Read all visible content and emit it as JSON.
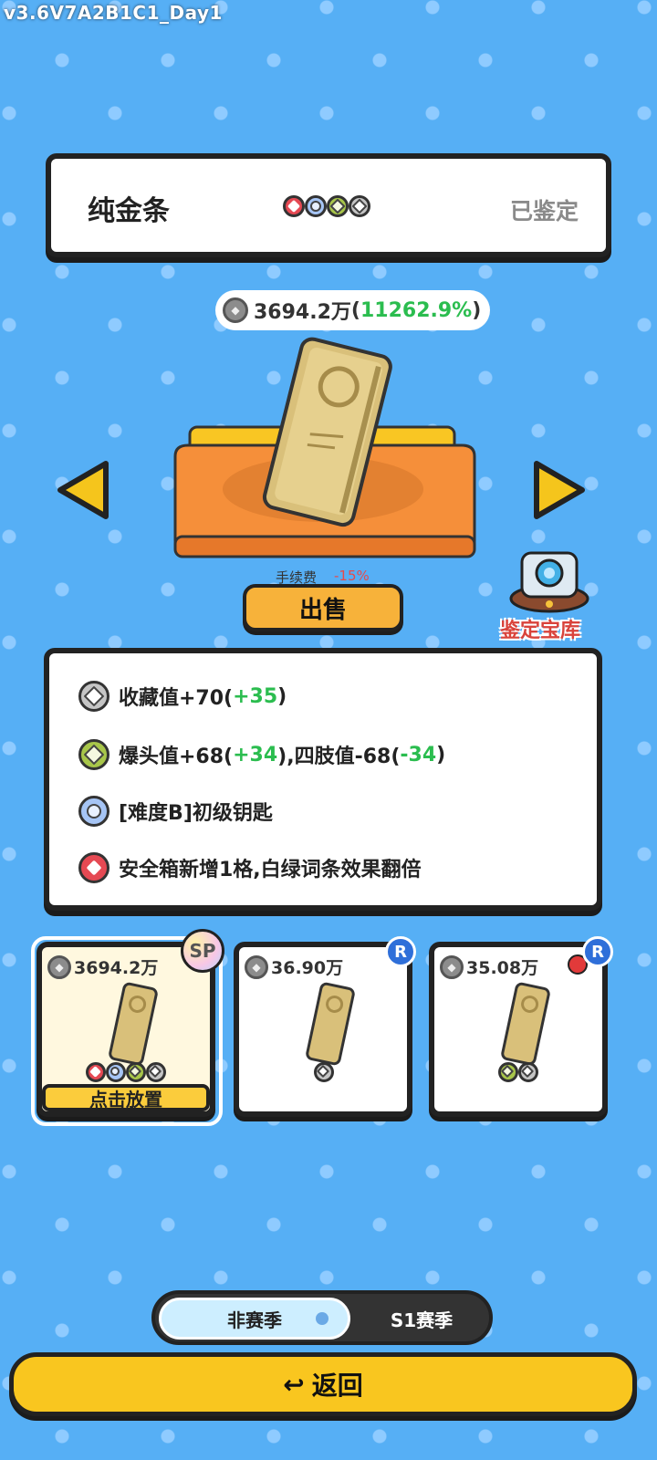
{
  "version": "v3.6V7A2B1C1_Day1",
  "item": {
    "name": "纯金条",
    "status": "已鉴定",
    "price": "3694.2万",
    "change": "11262.9%"
  },
  "sale": {
    "fee_label": "手续费",
    "fee_pct": "-15%",
    "sell_label": "出售"
  },
  "vault": {
    "label": "鉴定宝库"
  },
  "attributes": [
    {
      "prefix": "收藏值+70(",
      "bonus": "+35",
      "suffix": ")",
      "badge": "gray"
    },
    {
      "prefix": "爆头值+68(",
      "bonus": "+34",
      "mid": "),四肢值-68(",
      "bonus2": "-34",
      "suffix": ")",
      "badge": "green"
    },
    {
      "prefix": "[难度B]初级钥匙",
      "badge": "blue"
    },
    {
      "prefix": "安全箱新增1格,白绿词条效果翻倍",
      "badge": "red"
    }
  ],
  "inventory": [
    {
      "price": "3694.2万",
      "rarity": "SP",
      "badges": [
        "red",
        "blue",
        "green",
        "gray"
      ],
      "place_label": "点击放置",
      "selected": true
    },
    {
      "price": "36.90万",
      "rarity": "R",
      "badges": [
        "gray"
      ]
    },
    {
      "price": "35.08万",
      "rarity": "R",
      "badges": [
        "green",
        "gray"
      ],
      "alert": true
    }
  ],
  "season": {
    "active": "非赛季",
    "inactive": "S1赛季"
  },
  "back": {
    "label": "返回"
  },
  "colors": {
    "background": "#56aff5",
    "positive": "#2bbd4f",
    "negative": "#e84a4a",
    "button_yellow": "#f9c61f",
    "sell_orange": "#f7b23a"
  }
}
